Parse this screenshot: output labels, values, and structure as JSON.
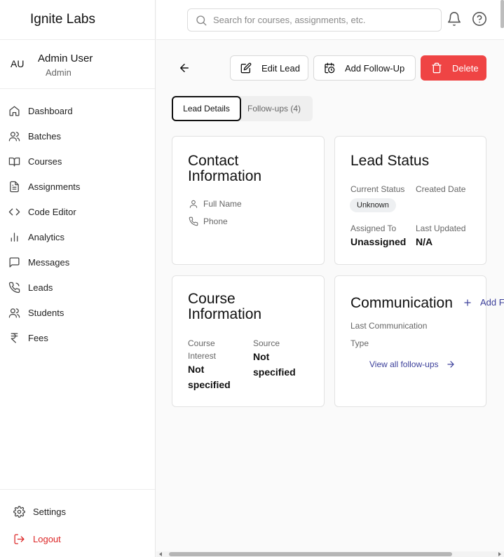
{
  "app": {
    "brand": "Ignite Labs"
  },
  "user": {
    "initials": "AU",
    "name": "Admin User",
    "role": "Admin"
  },
  "sidebar": {
    "items": [
      {
        "label": "Dashboard",
        "icon": "home-icon"
      },
      {
        "label": "Batches",
        "icon": "users-icon"
      },
      {
        "label": "Courses",
        "icon": "book-icon"
      },
      {
        "label": "Assignments",
        "icon": "file-text-icon"
      },
      {
        "label": "Code Editor",
        "icon": "code-icon"
      },
      {
        "label": "Analytics",
        "icon": "bar-chart-icon"
      },
      {
        "label": "Messages",
        "icon": "message-icon"
      },
      {
        "label": "Leads",
        "icon": "phone-icon"
      },
      {
        "label": "Students",
        "icon": "users-icon"
      },
      {
        "label": "Fees",
        "icon": "rupee-icon"
      }
    ],
    "settings_label": "Settings",
    "logout_label": "Logout"
  },
  "search": {
    "placeholder": "Search for courses, assignments, etc."
  },
  "toolbar": {
    "edit_label": "Edit Lead",
    "follow_label": "Add Follow-Up",
    "delete_label": "Delete"
  },
  "tabs": [
    {
      "label": "Lead Details",
      "active": true
    },
    {
      "label": "Follow-ups (4)",
      "active": false
    }
  ],
  "contact": {
    "title_line1": "Contact",
    "title_line2": "Information",
    "full_name_label": "Full Name",
    "phone_label": "Phone"
  },
  "status": {
    "title": "Lead Status",
    "current_status_label": "Current Status",
    "current_status_value": "Unknown",
    "created_date_label": "Created Date",
    "assigned_to_label": "Assigned To",
    "assigned_to_value": "Unassigned",
    "last_updated_label": "Last Updated",
    "last_updated_value": "N/A"
  },
  "course": {
    "title_line1": "Course",
    "title_line2": "Information",
    "interest_label_line1": "Course",
    "interest_label_line2": "Interest",
    "interest_value_line1": "Not",
    "interest_value_line2": "specified",
    "source_label": "Source",
    "source_value_line1": "Not",
    "source_value_line2": "specified"
  },
  "communication": {
    "title": "Communication",
    "add_label": "Add F",
    "last_comm_label": "Last Communication",
    "type_label": "Type",
    "view_all_label": "View all follow-ups"
  },
  "colors": {
    "delete_bg": "#ef4444",
    "logout": "#dc2626",
    "link": "#3b3f9a"
  }
}
